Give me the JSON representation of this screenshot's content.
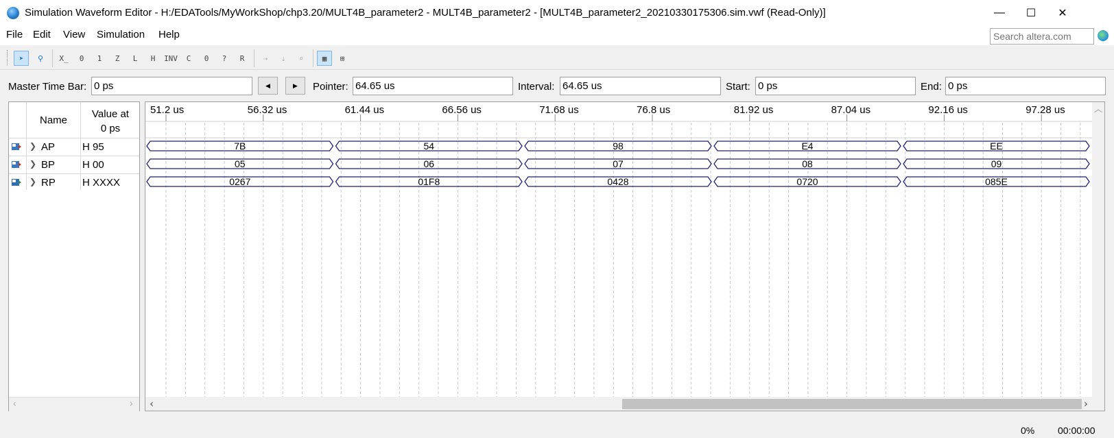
{
  "window": {
    "title": "Simulation Waveform Editor - H:/EDATools/MyWorkShop/chp3.20/MULT4B_parameter2 - MULT4B_parameter2 - [MULT4B_parameter2_20210330175306.sim.vwf (Read-Only)]",
    "app_icon": "quartus-globe-icon",
    "minimize_glyph": "—",
    "maximize_glyph": "☐",
    "close_glyph": "✕"
  },
  "menu": {
    "items": [
      "File",
      "Edit",
      "View",
      "Simulation",
      "Help"
    ],
    "search_placeholder": "Search altera.com"
  },
  "toolbar": {
    "icons": [
      "select-arrow-icon",
      "zoom-icon",
      "uninitialized-icon",
      "force-low-icon",
      "force-high-icon",
      "high-impedance-icon",
      "weak-low-icon",
      "weak-high-icon",
      "invert-icon",
      "count-value-icon",
      "clock-icon",
      "arbitrary-value-icon",
      "random-value-icon",
      "snap-to-grid-icon",
      "sort-icon",
      "find-icon",
      "grid-settings-icon",
      "snap-settings-icon"
    ]
  },
  "timebar": {
    "master_label": "Master Time Bar:",
    "master_value": "0 ps",
    "prev_glyph": "◀",
    "next_glyph": "▶",
    "pointer_label": "Pointer:",
    "pointer_value": "64.65 us",
    "interval_label": "Interval:",
    "interval_value": "64.65 us",
    "start_label": "Start:",
    "start_value": "0 ps",
    "end_label": "End:",
    "end_value": "0 ps"
  },
  "signals_header": {
    "name": "Name",
    "value_line1": "Value at",
    "value_line2": "0 ps"
  },
  "signals": [
    {
      "name": "AP",
      "value": "H 95",
      "kind": "input-pin-icon",
      "segments": [
        "7B",
        "54",
        "98",
        "E4",
        "EE"
      ]
    },
    {
      "name": "BP",
      "value": "H 00",
      "kind": "input-pin-icon",
      "segments": [
        "05",
        "06",
        "07",
        "08",
        "09"
      ]
    },
    {
      "name": "RP",
      "value": "H XXXX",
      "kind": "output-pin-icon",
      "segments": [
        "0267",
        "01F8",
        "0428",
        "0720",
        "085E"
      ]
    }
  ],
  "time_ticks": [
    "51.2 us",
    "56.32 us",
    "61.44 us",
    "66.56 us",
    "71.68 us",
    "76.8 us",
    "81.92 us",
    "87.04 us",
    "92.16 us",
    "97.28 us"
  ],
  "scroll": {
    "left_glyph": "‹",
    "right_glyph": "›",
    "up_glyph": "︿"
  },
  "status": {
    "progress": "0%",
    "elapsed": "00:00:00"
  }
}
